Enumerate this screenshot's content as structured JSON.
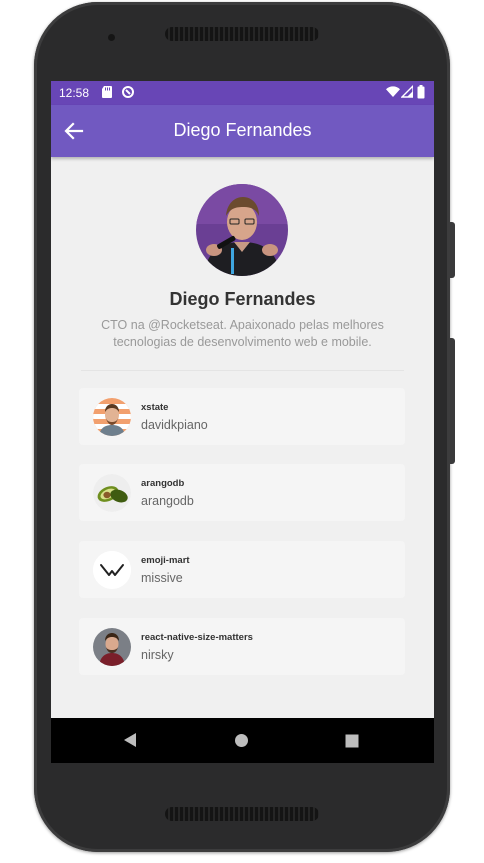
{
  "status_bar": {
    "time": "12:58",
    "left_icons": [
      "sd-card-icon",
      "data-saver-icon"
    ],
    "right_icons": [
      "wifi-icon",
      "signal-icon",
      "battery-icon"
    ],
    "color": "#6846b6"
  },
  "app_bar": {
    "title": "Diego Fernandes",
    "color": "#7159c1"
  },
  "profile": {
    "name": "Diego Fernandes",
    "bio_line1": "CTO na @Rocketseat. Apaixonado pelas melhores",
    "bio_line2": "tecnologias de desenvolvimento web e mobile."
  },
  "starred": [
    {
      "title": "xstate",
      "author": "davidkpiano",
      "avatar": "person-photo"
    },
    {
      "title": "arangodb",
      "author": "arangodb",
      "avatar": "avocado-logo"
    },
    {
      "title": "emoji-mart",
      "author": "missive",
      "avatar": "missive-logo"
    },
    {
      "title": "react-native-size-matters",
      "author": "nirsky",
      "avatar": "person-photo"
    }
  ],
  "nav_bar": [
    "back-nav-icon",
    "home-nav-icon",
    "recents-nav-icon"
  ]
}
